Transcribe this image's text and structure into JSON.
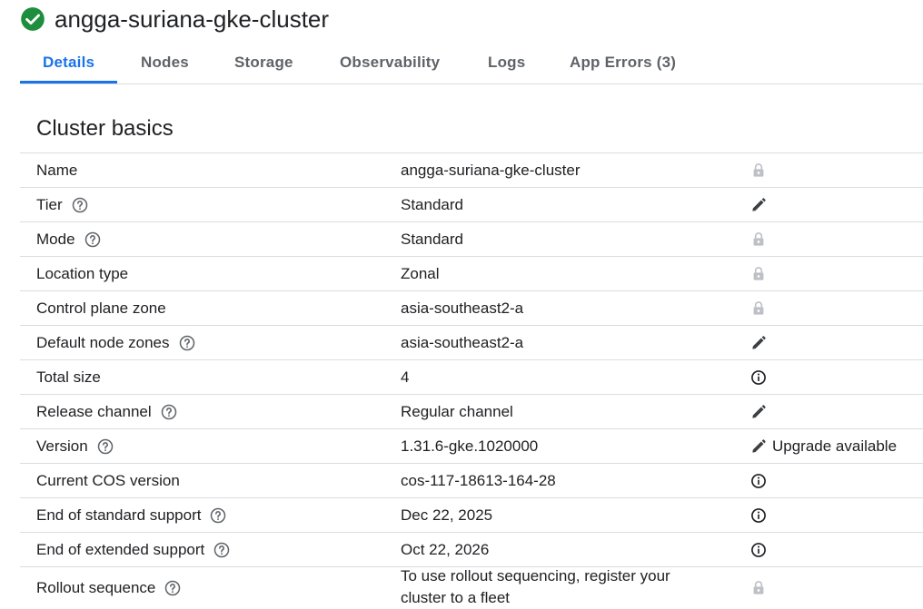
{
  "header": {
    "title": "angga-suriana-gke-cluster",
    "status_icon": "check-circle-icon",
    "status_color": "#1e8e3e"
  },
  "tabs": [
    {
      "label": "Details",
      "active": true
    },
    {
      "label": "Nodes"
    },
    {
      "label": "Storage"
    },
    {
      "label": "Observability"
    },
    {
      "label": "Logs"
    },
    {
      "label": "App Errors (3)"
    }
  ],
  "section": {
    "title": "Cluster basics"
  },
  "rows": [
    {
      "label": "Name",
      "value": "angga-suriana-gke-cluster",
      "help": false,
      "action_icon": "lock-icon"
    },
    {
      "label": "Tier",
      "value": "Standard",
      "help": true,
      "action_icon": "edit-icon"
    },
    {
      "label": "Mode",
      "value": "Standard",
      "help": true,
      "action_icon": "lock-icon"
    },
    {
      "label": "Location type",
      "value": "Zonal",
      "help": false,
      "action_icon": "lock-icon"
    },
    {
      "label": "Control plane zone",
      "value": "asia-southeast2-a",
      "help": false,
      "action_icon": "lock-icon"
    },
    {
      "label": "Default node zones",
      "value": "asia-southeast2-a",
      "help": true,
      "action_icon": "edit-icon"
    },
    {
      "label": "Total size",
      "value": "4",
      "help": false,
      "action_icon": "info-icon"
    },
    {
      "label": "Release channel",
      "value": "Regular channel",
      "help": true,
      "action_icon": "edit-icon"
    },
    {
      "label": "Version",
      "value": "1.31.6-gke.1020000",
      "help": true,
      "action_icon": "edit-icon",
      "action_text": "Upgrade available"
    },
    {
      "label": "Current COS version",
      "value": "cos-117-18613-164-28",
      "help": false,
      "action_icon": "info-icon"
    },
    {
      "label": "End of standard support",
      "value": "Dec 22, 2025",
      "help": true,
      "action_icon": "info-icon"
    },
    {
      "label": "End of extended support",
      "value": "Oct 22, 2026",
      "help": true,
      "action_icon": "info-icon"
    },
    {
      "label": "Rollout sequence",
      "value": "To use rollout sequencing, register your cluster to a fleet",
      "help": true,
      "action_icon": "lock-icon"
    }
  ],
  "colors": {
    "accent": "#1a73e8",
    "text": "#202124",
    "muted": "#5f6368",
    "lock": "#bdc1c6",
    "divider": "#dadce0"
  }
}
